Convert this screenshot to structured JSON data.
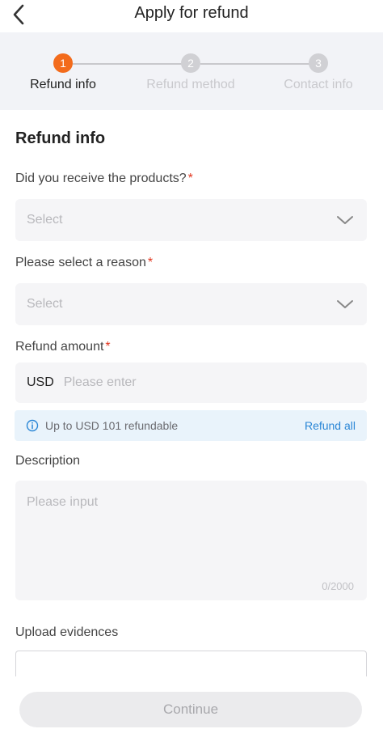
{
  "header": {
    "title": "Apply for refund"
  },
  "steps": [
    {
      "number": "1",
      "label": "Refund info",
      "active": true
    },
    {
      "number": "2",
      "label": "Refund method",
      "active": false
    },
    {
      "number": "3",
      "label": "Contact info",
      "active": false
    }
  ],
  "form": {
    "section_title": "Refund info",
    "required_mark": "*",
    "received": {
      "label": "Did you receive the products?",
      "placeholder": "Select"
    },
    "reason": {
      "label": "Please select a reason",
      "placeholder": "Select"
    },
    "amount": {
      "label": "Refund amount",
      "currency": "USD",
      "placeholder": "Please enter"
    },
    "notice": {
      "text": "Up to USD 101 refundable",
      "action": "Refund all"
    },
    "description": {
      "label": "Description",
      "placeholder": "Please input",
      "counter": "0/2000"
    },
    "upload": {
      "label": "Upload evidences"
    }
  },
  "footer": {
    "continue_label": "Continue"
  },
  "colors": {
    "accent": "#f36b1c",
    "required": "#e2361f",
    "link": "#2a86d6"
  }
}
